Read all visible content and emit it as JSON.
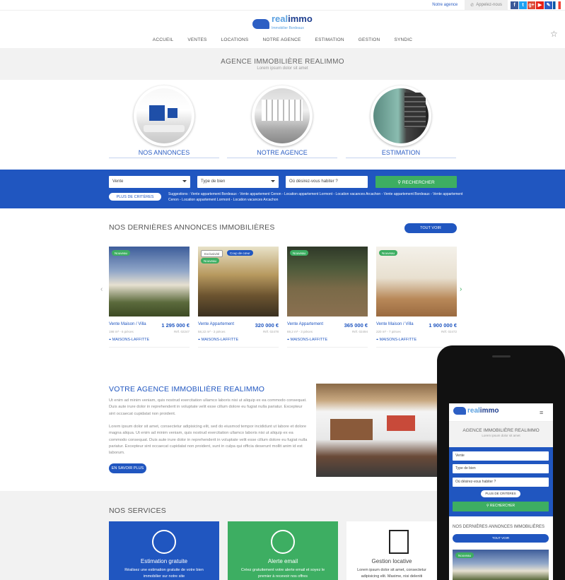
{
  "topbar": {
    "agency": "Notre agence",
    "call": "Appelez-nous",
    "social": [
      {
        "icon": "facebook-icon",
        "glyph": "f",
        "color": "#3b5998"
      },
      {
        "icon": "twitter-icon",
        "glyph": "t",
        "color": "#1da1f2"
      },
      {
        "icon": "googleplus-icon",
        "glyph": "g+",
        "color": "#dd4b39"
      },
      {
        "icon": "youtube-icon",
        "glyph": "▶",
        "color": "#e62117"
      },
      {
        "icon": "pen-icon",
        "glyph": "✎",
        "color": "#2d5fc4"
      }
    ],
    "flag": "fr-flag-icon"
  },
  "brand": {
    "name_a": "real",
    "name_b": "immo",
    "tagline": "Immobilier Bordeaux"
  },
  "nav": [
    "ACCUEIL",
    "VENTES",
    "LOCATIONS",
    "NOTRE AGENCE",
    "ESTIMATION",
    "GESTION",
    "SYNDIC"
  ],
  "hero": {
    "title": "AGENCE IMMOBILIÈRE REALIMMO",
    "subtitle": "Lorem ipsum dolor sit amet"
  },
  "features": [
    "NOS ANNONCES",
    "NOTRE AGENCE",
    "ESTIMATION"
  ],
  "search": {
    "type": "Vente",
    "property": "Type de bien",
    "where": "Où désirez-vous habiter ?",
    "submit": "RECHERCHER",
    "more": "PLUS DE CRITÈRES",
    "suggestions": "Suggestions : Vente appartement Bordeaux - Vente appartement Cenon - Location appartement Lormont - Location vacances Arcachon - Vente appartement Bordeaux - Vente appartement Cenon - Location appartement Lormont - Location vacances Arcachon"
  },
  "listings_section": {
    "title": "NOS DERNIÈRES ANNONCES IMMOBILIÈRES",
    "see_all": "TOUT VOIR"
  },
  "listings": [
    {
      "badges": [
        {
          "text": "Nouveau",
          "color": "#3dae62"
        }
      ],
      "type": "Vente Maison / Villa",
      "price": "1 295 000 €",
      "detail": "198 m² - 6 pièces",
      "ref": "Réf. 02247",
      "city": "MAISONS-LAFFITTE",
      "bg": "linear-gradient(180deg,#3d5d9a 0%,#90a6c8 35%,#e6e0d0 55%,#5b6a3c 80%,#3d4a24 100%)"
    },
    {
      "badges": [
        {
          "text": "Exclusivité",
          "color": "#fff"
        },
        {
          "text": "Coup de cœur",
          "color": "#2056c0"
        },
        {
          "text": "Nouveau",
          "color": "#3dae62"
        }
      ],
      "type": "Vente Appartement",
      "price": "320 000 €",
      "detail": "58,22 m² - 3 pièces",
      "ref": "Réf. 02478",
      "city": "MAISONS-LAFFITTE",
      "bg": "linear-gradient(180deg,#e8e2c8 0%,#b89a60 40%,#6c5430 70%,#3a3020 100%)"
    },
    {
      "badges": [
        {
          "text": "Nouveau",
          "color": "#3dae62"
        }
      ],
      "type": "Vente Appartement",
      "price": "365 000 €",
      "detail": "69,2 m² - 3 pièces",
      "ref": "Réf. 02494",
      "city": "MAISONS-LAFFITTE",
      "bg": "linear-gradient(180deg,#2e3828 0%,#4c5a3a 30%,#7a6a48 60%,#8a7050 100%)"
    },
    {
      "badges": [
        {
          "text": "Nouveau",
          "color": "#3dae62"
        }
      ],
      "type": "Vente Maison / Villa",
      "price": "1 900 000 €",
      "detail": "220 m² - 7 pièces",
      "ref": "Réf. 02472",
      "city": "MAISONS-LAFFITTE",
      "bg": "linear-gradient(180deg,#f4f1ea 0%,#e8e0d0 45%,#b88858 75%,#9a6a40 100%)"
    }
  ],
  "about": {
    "title": "VOTRE AGENCE IMMOBILIÈRE REALIMMO",
    "p1": "Ut enim ad minim veniam, quis nostrud exercitation ullamco laboris nisi ut aliquip ex ea commodo consequat. Duis aute irure dolor in reprehenderit in voluptate velit esse cillum dolore eu fugiat nulla pariatur. Excepteur sint occaecat cupidatat non proident.",
    "p2": "Lorem ipsum dolor sit amet, consectetur adipisicing elit, sed do eiusmod tempor incididunt ut labore et dolore magna aliqua. Ut enim ad minim veniam, quis nostrud exercitation ullamco laboris nisi ut aliquip ex ea commodo consequat. Duis aute irure dolor in reprehenderit in voluptate velit esse cillum dolore eu fugiat nulla pariatur. Excepteur sint occaecat cupidatat non proident, sunt in culpa qui officia deserunt mollit anim id est laborum.",
    "button": "EN SAVOIR PLUS"
  },
  "services": {
    "title": "NOS SERVICES",
    "items": [
      {
        "title": "Estimation gratuite",
        "desc": "Réalisez une estimation gratuite de votre bien immobilier sur notre site",
        "color": "#2056c0",
        "icon": "gauge-icon"
      },
      {
        "title": "Alerte email",
        "desc": "Créez gratuitement votre alerte email et soyez le premier à recevoir nos offres",
        "color": "#3dae62",
        "icon": "envelope-icon"
      },
      {
        "title": "Gestion locative",
        "desc": "Lorem ipsum dolor sit amet, consectetur adipisicing elit. Maxime, nisi deleniti",
        "color": "#fff",
        "icon": "documents-icon"
      }
    ]
  },
  "mobile": {
    "hero_title": "AGENCE IMMOBILIÈRE REALIMMO",
    "hero_sub": "Lorem ipsum dolor sit amet",
    "type": "Vente",
    "property": "Type de bien",
    "where": "Où désirez-vous habiter ?",
    "more": "PLUS DE CRITÈRES",
    "submit": "RECHERCHER",
    "section": "NOS DERNIÈRES ANNONCES IMMOBILIÈRES",
    "see_all": "TOUT VOIR",
    "badge": "Nouveau"
  }
}
